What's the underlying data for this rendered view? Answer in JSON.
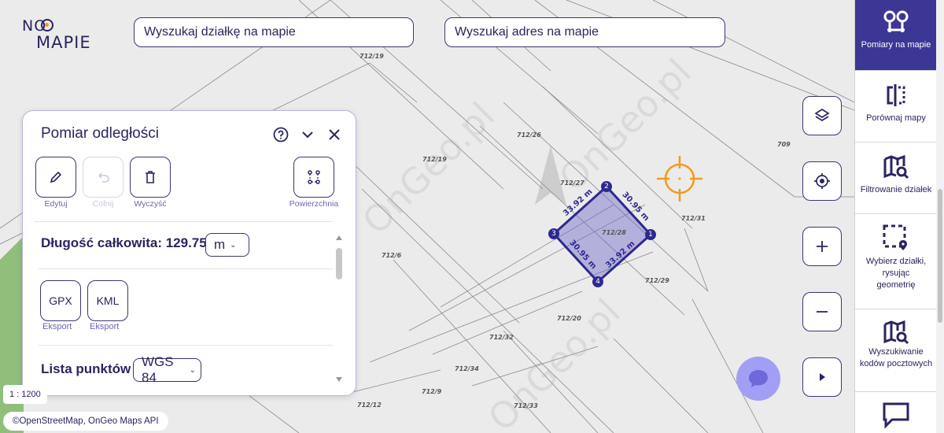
{
  "app": {
    "logo_top": "NO",
    "logo_bottom": "MAPIE",
    "accent_color": "#3c3794",
    "highlight_color": "#f39a1c"
  },
  "search": {
    "parcel_label": "Wyszukaj działkę na mapie",
    "address_label": "Wyszukaj adres na mapie"
  },
  "panel": {
    "title": "Pomiar odległości",
    "help_icon": "question-circle-icon",
    "collapse_icon": "chevron-down-icon",
    "close_icon": "close-icon",
    "tools": {
      "edit": "Edytuj",
      "undo": "Cofnij",
      "clear": "Wyczyść",
      "area": "Powierzchnia"
    },
    "total_length": "Długość całkowita: 129.75",
    "unit": "m",
    "export": {
      "gpx": "GPX",
      "kml": "KML",
      "label": "Eksport"
    },
    "points_label": "Lista punktów",
    "crs": "WGS 84"
  },
  "map": {
    "scale": "1 : 1200",
    "attribution": "©OpenStreetMap, OnGeo Maps API",
    "watermark": "OnGeo.pl",
    "parcels": [
      "712/19",
      "712/26",
      "712/19",
      "712/27",
      "712/31",
      "709",
      "712/28",
      "712/6",
      "712/29",
      "712/20",
      "712/32",
      "712/34",
      "712/9",
      "712/12",
      "712/33"
    ],
    "measurement": {
      "vertices": [
        "1",
        "2",
        "3",
        "4"
      ],
      "edges": [
        "33.92 m",
        "30.95 m",
        "30.95 m",
        "33.92 m"
      ],
      "parcel": "712/28"
    }
  },
  "sidebar": {
    "items": [
      {
        "label": "Pomiary na mapie",
        "icon": "measure-pins-icon"
      },
      {
        "label": "Porównaj mapy",
        "icon": "compare-maps-icon"
      },
      {
        "label": "Filtrowanie działek",
        "icon": "map-search-icon"
      },
      {
        "label": "Wybierz działki, rysując geometrię",
        "icon": "select-area-icon"
      },
      {
        "label": "Wyszukiwanie kodów pocztowych",
        "icon": "map-search-icon"
      },
      {
        "label": "",
        "icon": "chat-icon"
      }
    ]
  }
}
